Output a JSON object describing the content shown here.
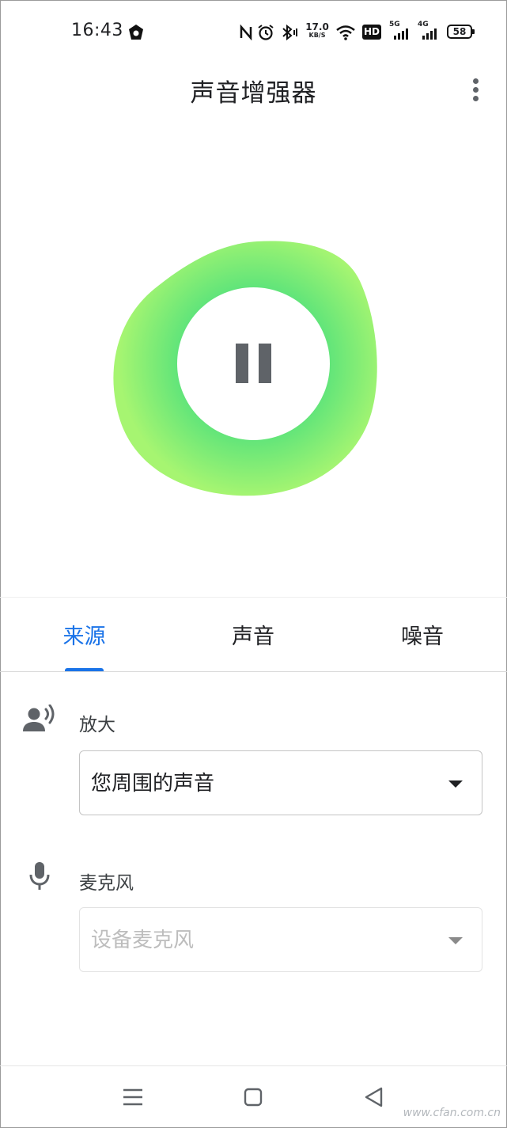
{
  "status_bar": {
    "time": "16:43",
    "net_speed_value": "17.0",
    "net_speed_unit": "KB/S",
    "hd_label": "HD",
    "signal_1_label": "5G",
    "signal_2_label": "4G",
    "battery": "58",
    "icons": [
      "app-notification-icon",
      "nfc-icon",
      "alarm-icon",
      "bluetooth-icon",
      "wifi-icon",
      "hd-icon",
      "signal-5g-icon",
      "signal-4g-icon",
      "battery-icon"
    ]
  },
  "app_bar": {
    "title": "声音增强器",
    "menu_icon": "more-vert-icon"
  },
  "player": {
    "state_icon": "pause-icon",
    "colors": {
      "blob_inner": "#5fe47a",
      "blob_outer": "#a6f571"
    }
  },
  "tabs": [
    {
      "label": "来源",
      "active": true
    },
    {
      "label": "声音",
      "active": false
    },
    {
      "label": "噪音",
      "active": false
    }
  ],
  "source": {
    "amplify": {
      "label": "放大",
      "icon": "person-voice-icon",
      "selected": "您周围的声音"
    },
    "microphone": {
      "label": "麦克风",
      "icon": "mic-icon",
      "placeholder": "设备麦克风",
      "enabled": false
    }
  },
  "nav_bar": {
    "buttons": [
      "menu-icon",
      "home-icon",
      "back-icon"
    ]
  },
  "watermark": "www.cfan.com.cn",
  "accent_color": "#1a73e8"
}
